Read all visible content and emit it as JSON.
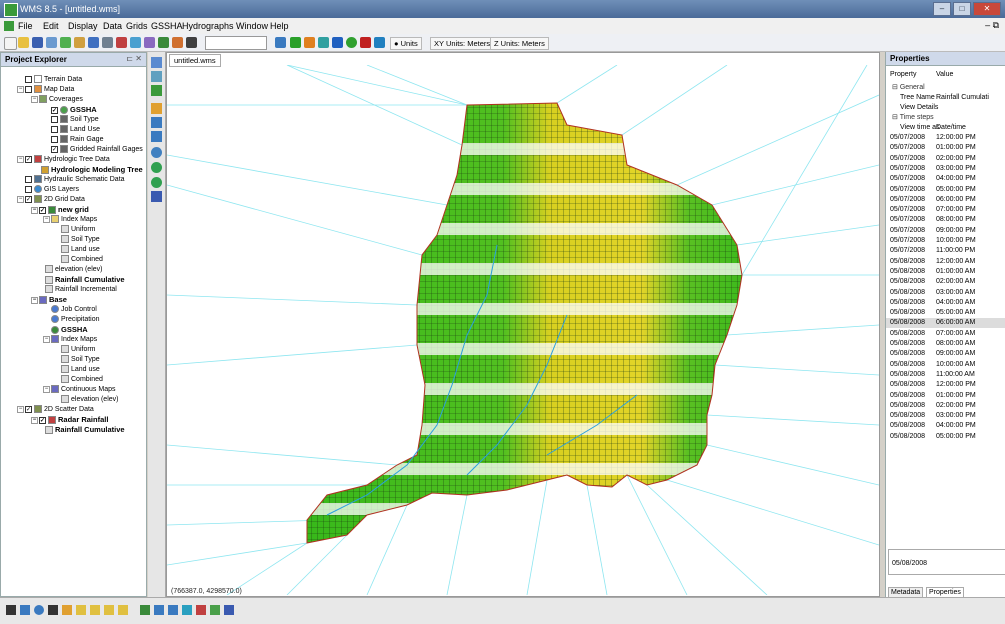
{
  "window": {
    "title": "WMS 8.5 - [untitled.wms]"
  },
  "menu": [
    "File",
    "Edit",
    "Display",
    "Data",
    "Grids",
    "GSSHA",
    "Hydrographs",
    "Window",
    "Help"
  ],
  "toolbar": {
    "units_label": "Units",
    "xy_units": "XY Units: Meters",
    "z_units": "Z Units: Meters"
  },
  "explorer": {
    "title": "Project Explorer",
    "items": [
      "Terrain Data",
      "Map Data",
      "Coverages",
      "GSSHA",
      "Soil Type",
      "Land Use",
      "Rain Gage",
      "Gridded Rainfall Gages",
      "Hydrologic Tree Data",
      "Hydrologic Modeling Tree",
      "Hydraulic Schematic Data",
      "GIS Layers",
      "2D Grid Data",
      "new grid",
      "Index Maps",
      "Uniform",
      "Soil Type",
      "Land use",
      "Combined",
      "elevation (elev)",
      "Rainfall Cumulative",
      "Rainfall Incremental",
      "Base",
      "Job Control",
      "Precipitation",
      "GSSHA",
      "Index Maps",
      "Uniform",
      "Soil Type",
      "Land use",
      "Combined",
      "Continuous Maps",
      "elevation (elev)",
      "2D Scatter Data",
      "Radar Rainfall",
      "Rainfall Cumulative"
    ]
  },
  "canvas": {
    "tab": "untitled.wms",
    "coordinates": "(766387.0, 4298570.0)"
  },
  "properties": {
    "title": "Properties",
    "col_property": "Property",
    "col_value": "Value",
    "general": "General",
    "tree_name_label": "Tree Name",
    "tree_name_value": "Rainfall Cumulati",
    "view_details": "View Details",
    "time_steps": "Time steps",
    "view_time_as": "View time as",
    "view_time_value": "Date/time",
    "rows": [
      [
        "05/07/2008",
        "12:00:00 PM"
      ],
      [
        "05/07/2008",
        "01:00:00 PM"
      ],
      [
        "05/07/2008",
        "02:00:00 PM"
      ],
      [
        "05/07/2008",
        "03:00:00 PM"
      ],
      [
        "05/07/2008",
        "04:00:00 PM"
      ],
      [
        "05/07/2008",
        "05:00:00 PM"
      ],
      [
        "05/07/2008",
        "06:00:00 PM"
      ],
      [
        "05/07/2008",
        "07:00:00 PM"
      ],
      [
        "05/07/2008",
        "08:00:00 PM"
      ],
      [
        "05/07/2008",
        "09:00:00 PM"
      ],
      [
        "05/07/2008",
        "10:00:00 PM"
      ],
      [
        "05/07/2008",
        "11:00:00 PM"
      ],
      [
        "05/08/2008",
        "12:00:00 AM"
      ],
      [
        "05/08/2008",
        "01:00:00 AM"
      ],
      [
        "05/08/2008",
        "02:00:00 AM"
      ],
      [
        "05/08/2008",
        "03:00:00 AM"
      ],
      [
        "05/08/2008",
        "04:00:00 AM"
      ],
      [
        "05/08/2008",
        "05:00:00 AM"
      ],
      [
        "05/08/2008",
        "06:00:00 AM"
      ],
      [
        "05/08/2008",
        "07:00:00 AM"
      ],
      [
        "05/08/2008",
        "08:00:00 AM"
      ],
      [
        "05/08/2008",
        "09:00:00 AM"
      ],
      [
        "05/08/2008",
        "10:00:00 AM"
      ],
      [
        "05/08/2008",
        "11:00:00 AM"
      ],
      [
        "05/08/2008",
        "12:00:00 PM"
      ],
      [
        "05/08/2008",
        "01:00:00 PM"
      ],
      [
        "05/08/2008",
        "02:00:00 PM"
      ],
      [
        "05/08/2008",
        "03:00:00 PM"
      ],
      [
        "05/08/2008",
        "04:00:00 PM"
      ],
      [
        "05/08/2008",
        "05:00:00 PM"
      ]
    ],
    "selected_value": "05/08/2008",
    "tab_metadata": "Metadata",
    "tab_properties": "Properties"
  },
  "colors": {
    "grid_green": "#3cb81e",
    "grid_yellow": "#d8d020",
    "tin_line": "#8ee6f0",
    "label_cyan": "#2ad8e8"
  }
}
